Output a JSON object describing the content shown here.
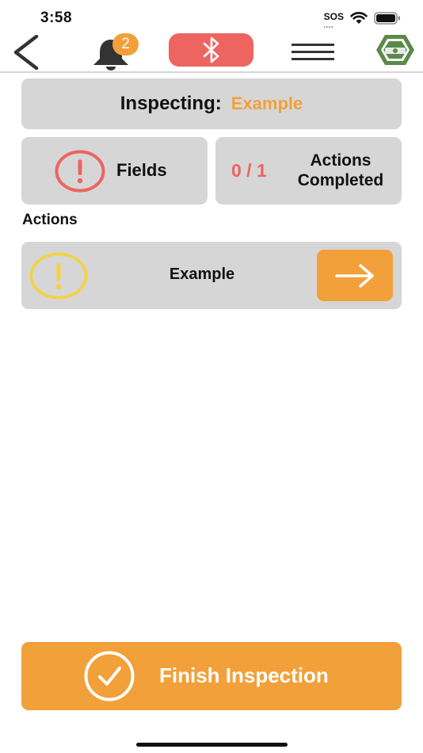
{
  "status_bar": {
    "time": "3:58",
    "sos": "SOS",
    "icons": [
      "wifi-icon",
      "battery-icon"
    ]
  },
  "nav": {
    "back_icon": "chevron-left-icon",
    "notification_count": "2",
    "bluetooth_icon": "bluetooth-icon",
    "menu_icon": "hamburger-menu-icon",
    "logo_icon": "hexagon-logo-icon"
  },
  "inspecting": {
    "label": "Inspecting:",
    "value": "Example"
  },
  "fields_card": {
    "label": "Fields",
    "icon": "exclamation-circle-icon"
  },
  "actions_card": {
    "count": "0 / 1",
    "label_line1": "Actions",
    "label_line2": "Completed"
  },
  "actions_section": {
    "title": "Actions",
    "items": [
      {
        "label": "Example",
        "status_icon": "warning-circle-icon",
        "go_icon": "arrow-right-icon"
      }
    ]
  },
  "finish": {
    "label": "Finish Inspection",
    "icon": "check-circle-icon"
  },
  "colors": {
    "accent": "#f2a03a",
    "danger": "#ed6461",
    "warning": "#f5d23c",
    "card": "#d6d6d6",
    "logo_green": "#5a8a4a"
  }
}
